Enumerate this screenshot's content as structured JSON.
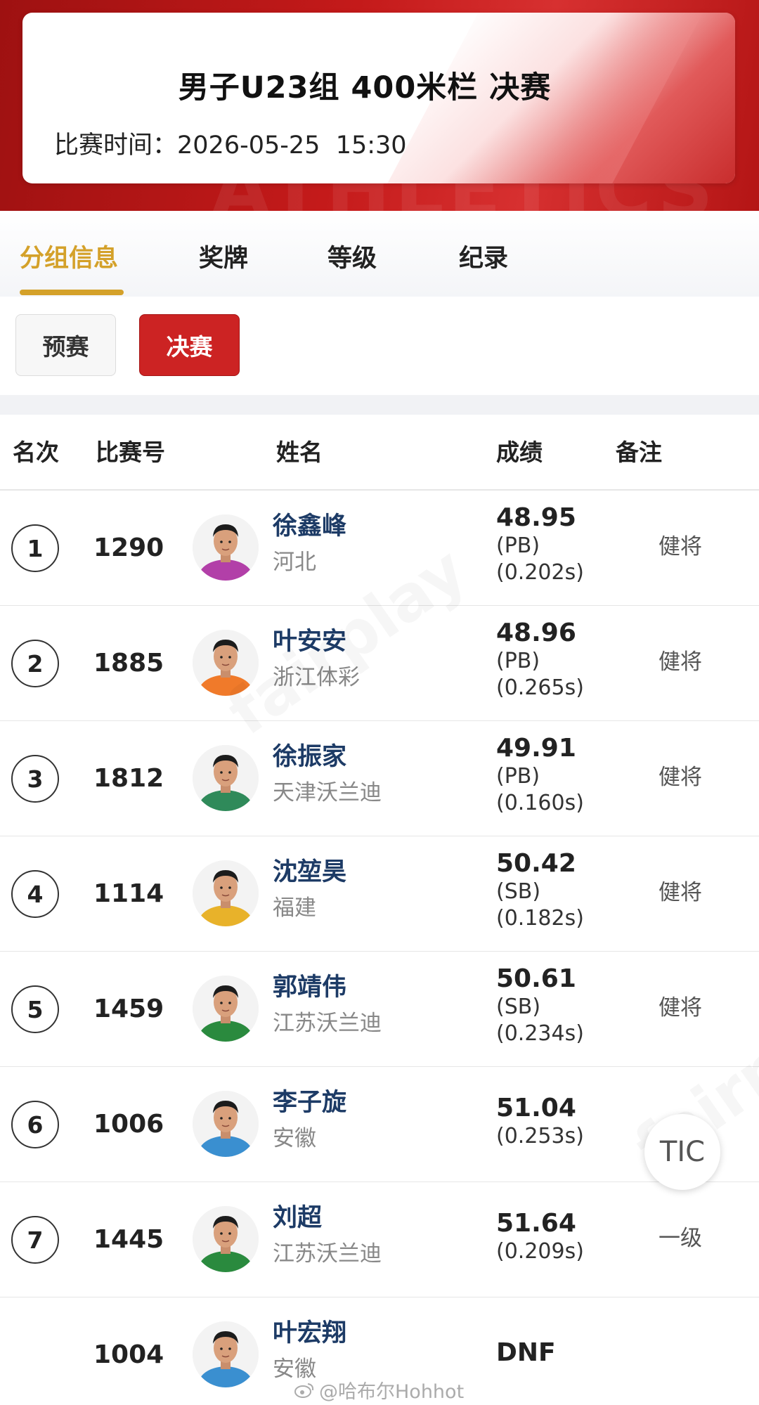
{
  "header": {
    "title": "男子U23组 400米栏 决赛",
    "time_label": "比赛时间：",
    "date": "2026-05-25",
    "time": "15:30",
    "watermark": "ATHLETICS"
  },
  "tabs": [
    {
      "label": "分组信息",
      "active": true
    },
    {
      "label": "奖牌",
      "active": false
    },
    {
      "label": "等级",
      "active": false
    },
    {
      "label": "纪录",
      "active": false
    }
  ],
  "rounds": [
    {
      "label": "预赛",
      "active": false
    },
    {
      "label": "决赛",
      "active": true
    }
  ],
  "table": {
    "headers": {
      "rank": "名次",
      "bib": "比赛号",
      "name": "姓名",
      "result": "成绩",
      "note": "备注"
    },
    "rows": [
      {
        "rank": "1",
        "bib": "1290",
        "name": "徐鑫峰",
        "team": "河北",
        "result": "48.95",
        "notes": [
          "(PB)",
          "(0.202s)"
        ],
        "grade": "健将",
        "jersey": "#b23fa8"
      },
      {
        "rank": "2",
        "bib": "1885",
        "name": "叶安安",
        "team": "浙江体彩",
        "result": "48.96",
        "notes": [
          "(PB)",
          "(0.265s)"
        ],
        "grade": "健将",
        "jersey": "#f07a2a"
      },
      {
        "rank": "3",
        "bib": "1812",
        "name": "徐振家",
        "team": "天津沃兰迪",
        "result": "49.91",
        "notes": [
          "(PB)",
          "(0.160s)"
        ],
        "grade": "健将",
        "jersey": "#2f8a5a"
      },
      {
        "rank": "4",
        "bib": "1114",
        "name": "沈堃昊",
        "team": "福建",
        "result": "50.42",
        "notes": [
          "(SB)",
          "(0.182s)"
        ],
        "grade": "健将",
        "jersey": "#e8b22a"
      },
      {
        "rank": "5",
        "bib": "1459",
        "name": "郭靖伟",
        "team": "江苏沃兰迪",
        "result": "50.61",
        "notes": [
          "(SB)",
          "(0.234s)"
        ],
        "grade": "健将",
        "jersey": "#2a8a3e"
      },
      {
        "rank": "6",
        "bib": "1006",
        "name": "李子旋",
        "team": "安徽",
        "result": "51.04",
        "notes": [
          "(0.253s)"
        ],
        "grade": "",
        "jersey": "#3a8fd0"
      },
      {
        "rank": "7",
        "bib": "1445",
        "name": "刘超",
        "team": "江苏沃兰迪",
        "result": "51.64",
        "notes": [
          "(0.209s)"
        ],
        "grade": "一级",
        "jersey": "#2a8a3e"
      },
      {
        "rank": "",
        "bib": "1004",
        "name": "叶宏翔",
        "team": "安徽",
        "result": "DNF",
        "notes": [],
        "grade": "",
        "jersey": "#3a8fd0"
      }
    ]
  },
  "float_button": {
    "label": "TIC"
  },
  "credit": "@哈布尔Hohhot",
  "watermarks": [
    "fairplay"
  ]
}
